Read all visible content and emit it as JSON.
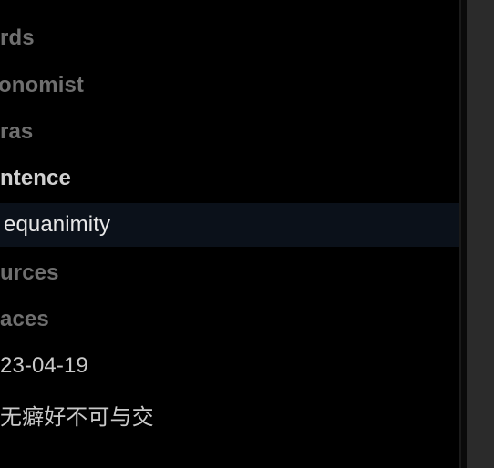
{
  "sidebar": {
    "items": [
      {
        "label": "rds"
      },
      {
        "label": "onomist"
      },
      {
        "label": "ras"
      },
      {
        "label": "ntence"
      },
      {
        "label": "equanimity"
      },
      {
        "label": "urces"
      },
      {
        "label": "aces"
      },
      {
        "label": "23-04-19"
      },
      {
        "label": "无癖好不可与交"
      }
    ]
  }
}
